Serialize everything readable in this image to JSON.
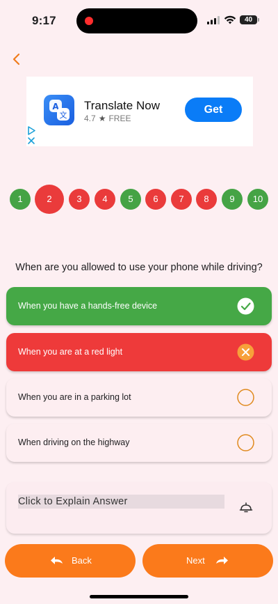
{
  "status": {
    "time": "9:17",
    "battery": "40"
  },
  "ad": {
    "app_name": "Translate Now",
    "rating": "4.7",
    "price": "FREE",
    "cta": "Get"
  },
  "question_numbers": [
    {
      "label": "1",
      "state": "correct"
    },
    {
      "label": "2",
      "state": "current-wrong"
    },
    {
      "label": "3",
      "state": "wrong"
    },
    {
      "label": "4",
      "state": "wrong"
    },
    {
      "label": "5",
      "state": "correct"
    },
    {
      "label": "6",
      "state": "wrong"
    },
    {
      "label": "7",
      "state": "wrong"
    },
    {
      "label": "8",
      "state": "wrong"
    },
    {
      "label": "9",
      "state": "correct"
    },
    {
      "label": "10",
      "state": "correct"
    }
  ],
  "question": "When are you allowed to use your phone while driving?",
  "answers": [
    {
      "text": "When you have a hands-free device",
      "state": "correct",
      "icon": "check-circle-icon"
    },
    {
      "text": "When you are at a red light",
      "state": "wrong",
      "icon": "x-circle-icon"
    },
    {
      "text": "When you are in a parking lot",
      "state": "neutral",
      "icon": "empty-circle-icon"
    },
    {
      "text": "When driving on the highway",
      "state": "neutral",
      "icon": "empty-circle-icon"
    }
  ],
  "explain": {
    "label": "Click to Explain Answer",
    "icon": "bell-icon"
  },
  "nav": {
    "back_label": "Back",
    "next_label": "Next"
  },
  "colors": {
    "background": "#fdeff2",
    "correct": "#45a846",
    "wrong": "#ee3a3a",
    "accent": "#fb7a1b",
    "ad_button": "#0a7cf7"
  }
}
